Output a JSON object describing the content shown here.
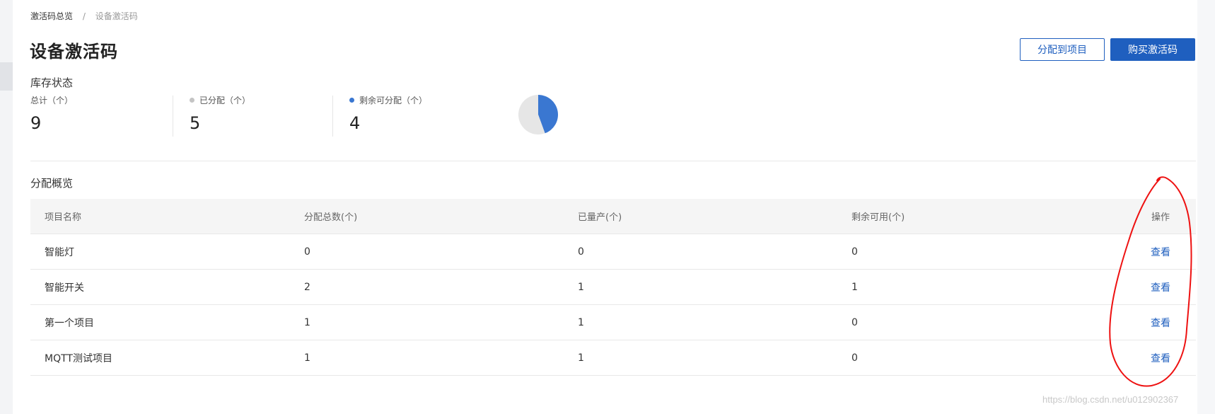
{
  "breadcrumb": {
    "parent": "激活码总览",
    "separator": "/",
    "current": "设备激活码"
  },
  "page_title": "设备激活码",
  "buttons": {
    "assign": "分配到项目",
    "buy": "购买激活码"
  },
  "inventory": {
    "title": "库存状态",
    "total": {
      "label": "总计（个）",
      "value": "9"
    },
    "assigned": {
      "label": "已分配（个）",
      "value": "5",
      "color": "#c4c4c4"
    },
    "remaining": {
      "label": "剩余可分配（个）",
      "value": "4",
      "color": "#3a77d1"
    }
  },
  "chart_data": {
    "type": "pie",
    "slices": [
      {
        "label": "已分配",
        "value": 5,
        "color": "#e6e6e6"
      },
      {
        "label": "剩余可分配",
        "value": 4,
        "color": "#3a77d1"
      }
    ]
  },
  "overview": {
    "title": "分配概览",
    "columns": [
      "项目名称",
      "分配总数(个)",
      "已量产(个)",
      "剩余可用(个)",
      "操作"
    ],
    "rows": [
      {
        "name": "智能灯",
        "total": "0",
        "produced": "0",
        "available": "0",
        "action": "查看"
      },
      {
        "name": "智能开关",
        "total": "2",
        "produced": "1",
        "available": "1",
        "action": "查看"
      },
      {
        "name": "第一个项目",
        "total": "1",
        "produced": "1",
        "available": "0",
        "action": "查看"
      },
      {
        "name": "MQTT测试项目",
        "total": "1",
        "produced": "1",
        "available": "0",
        "action": "查看"
      }
    ]
  },
  "watermark": "https://blog.csdn.net/u012902367"
}
